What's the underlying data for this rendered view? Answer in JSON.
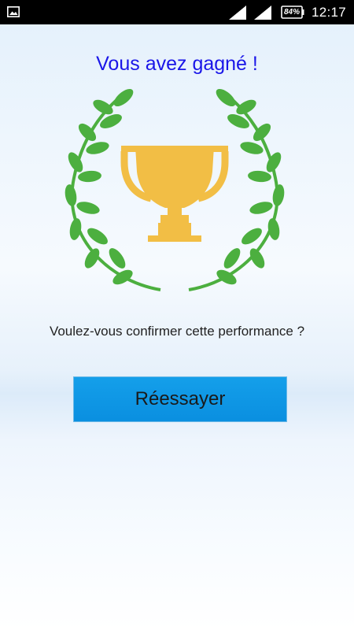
{
  "status_bar": {
    "icons": [
      "gallery-icon",
      "signal-icon",
      "signal-icon",
      "battery-icon"
    ],
    "battery_level": "84%",
    "time": "12:17",
    "background_color": "#000000",
    "foreground_color": "#ffffff"
  },
  "result": {
    "title": "Vous avez gagné !",
    "title_color": "#1a16e8",
    "illustration": {
      "icons": [
        "trophy-icon",
        "laurel-wreath-icon"
      ],
      "trophy_color": "#f2be45",
      "laurel_color": "#4caf3f"
    },
    "question": "Voulez-vous confirmer cette performance ?",
    "retry_label": "Réessayer",
    "retry_color": "#0e96e6"
  }
}
